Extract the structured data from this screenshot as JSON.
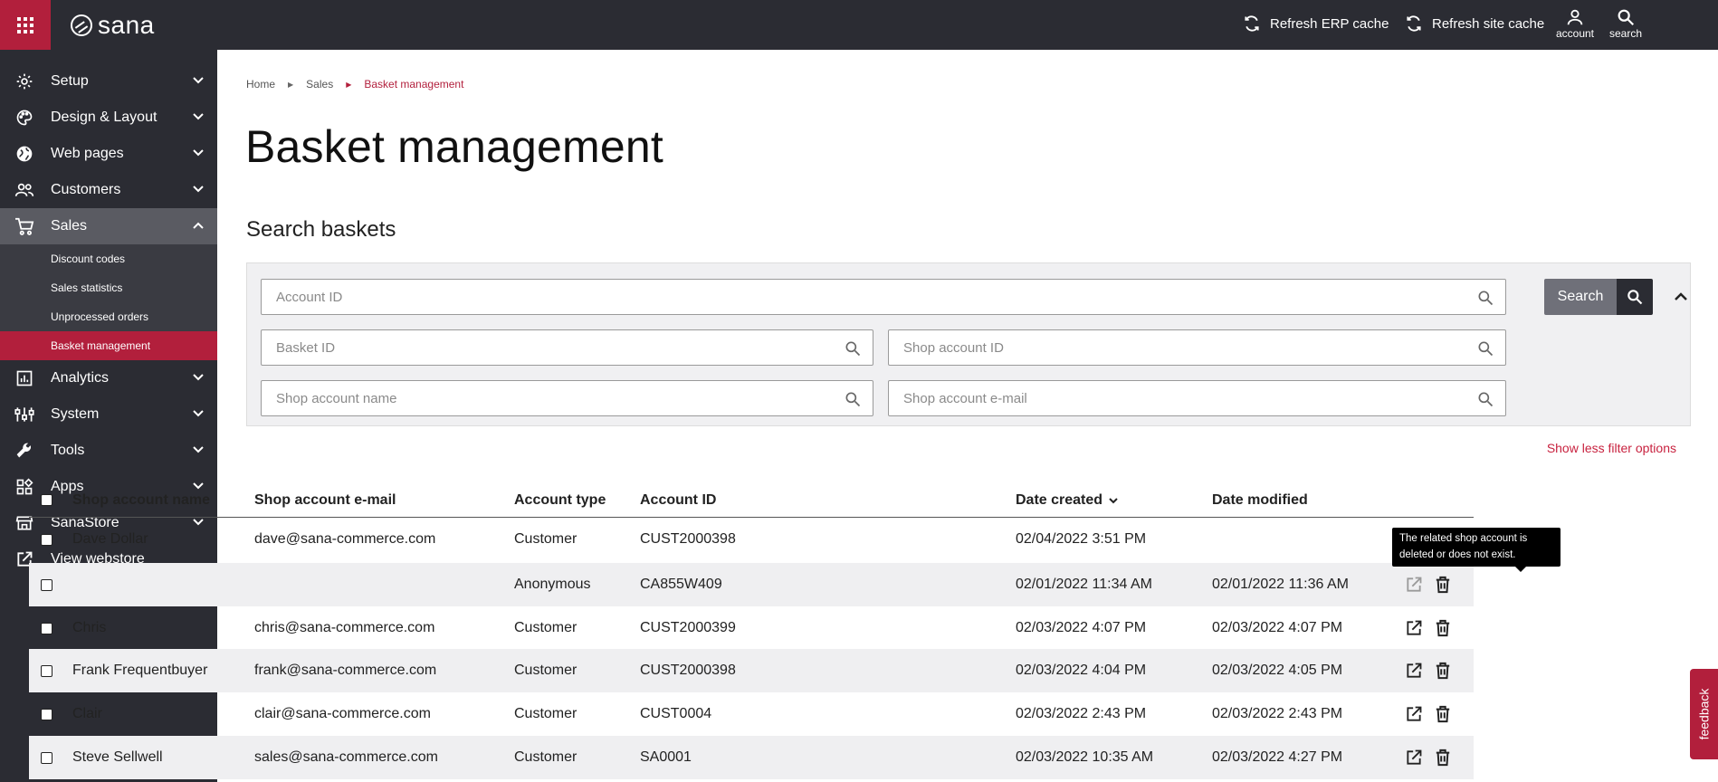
{
  "brand": {
    "name": "sana"
  },
  "topbar": {
    "refresh_erp": "Refresh ERP cache",
    "refresh_site": "Refresh site cache",
    "account": "account",
    "search": "search"
  },
  "sidebar": {
    "items": [
      {
        "label": "Setup",
        "icon": "gear-icon"
      },
      {
        "label": "Design & Layout",
        "icon": "palette-icon"
      },
      {
        "label": "Web pages",
        "icon": "globe-icon"
      },
      {
        "label": "Customers",
        "icon": "users-icon"
      },
      {
        "label": "Sales",
        "icon": "cart-icon"
      },
      {
        "label": "Analytics",
        "icon": "chart-icon"
      },
      {
        "label": "System",
        "icon": "sliders-icon"
      },
      {
        "label": "Tools",
        "icon": "wrench-icon"
      },
      {
        "label": "Apps",
        "icon": "apps-icon"
      },
      {
        "label": "SanaStore",
        "icon": "store-icon"
      },
      {
        "label": "View webstore",
        "icon": "external-link-icon"
      }
    ],
    "sales_sub": [
      {
        "label": "Discount codes"
      },
      {
        "label": "Sales statistics"
      },
      {
        "label": "Unprocessed orders"
      },
      {
        "label": "Basket management"
      }
    ]
  },
  "breadcrumb": {
    "home": "Home",
    "sales": "Sales",
    "current": "Basket management"
  },
  "page_title": "Basket management",
  "section_title": "Search baskets",
  "filters": {
    "account_id": "Account ID",
    "basket_id": "Basket ID",
    "shop_account_id": "Shop account ID",
    "shop_account_name": "Shop account name",
    "shop_account_email": "Shop account e-mail",
    "search_label": "Search",
    "less_options": "Show less filter options"
  },
  "table": {
    "headers": {
      "name": "Shop account name",
      "email": "Shop account e-mail",
      "type": "Account type",
      "account_id": "Account ID",
      "created": "Date created",
      "modified": "Date modified"
    },
    "rows": [
      {
        "name": "Dave Dollar",
        "email": "dave@sana-commerce.com",
        "type": "Customer",
        "account_id": "CUST2000398",
        "created": "02/04/2022 3:51 PM",
        "modified": ""
      },
      {
        "name": "",
        "email": "",
        "type": "Anonymous",
        "account_id": "CA855W409",
        "created": "02/01/2022 11:34 AM",
        "modified": "02/01/2022 11:36 AM"
      },
      {
        "name": "Chris",
        "email": "chris@sana-commerce.com",
        "type": "Customer",
        "account_id": "CUST2000399",
        "created": "02/03/2022 4:07 PM",
        "modified": "02/03/2022 4:07 PM"
      },
      {
        "name": "Frank Frequentbuyer",
        "email": "frank@sana-commerce.com",
        "type": "Customer",
        "account_id": "CUST2000398",
        "created": "02/03/2022 4:04 PM",
        "modified": "02/03/2022 4:05 PM"
      },
      {
        "name": "Clair",
        "email": "clair@sana-commerce.com",
        "type": "Customer",
        "account_id": "CUST0004",
        "created": "02/03/2022 2:43 PM",
        "modified": "02/03/2022 2:43 PM"
      },
      {
        "name": "Steve Sellwell",
        "email": "sales@sana-commerce.com",
        "type": "Customer",
        "account_id": "SA0001",
        "created": "02/03/2022 10:35 AM",
        "modified": "02/03/2022 4:27 PM"
      }
    ]
  },
  "tooltip": "The related shop account is deleted or does not exist.",
  "feedback": "feedback",
  "colors": {
    "brand": "#b21f3c",
    "dark": "#2b2c33",
    "link": "#c8223f"
  }
}
